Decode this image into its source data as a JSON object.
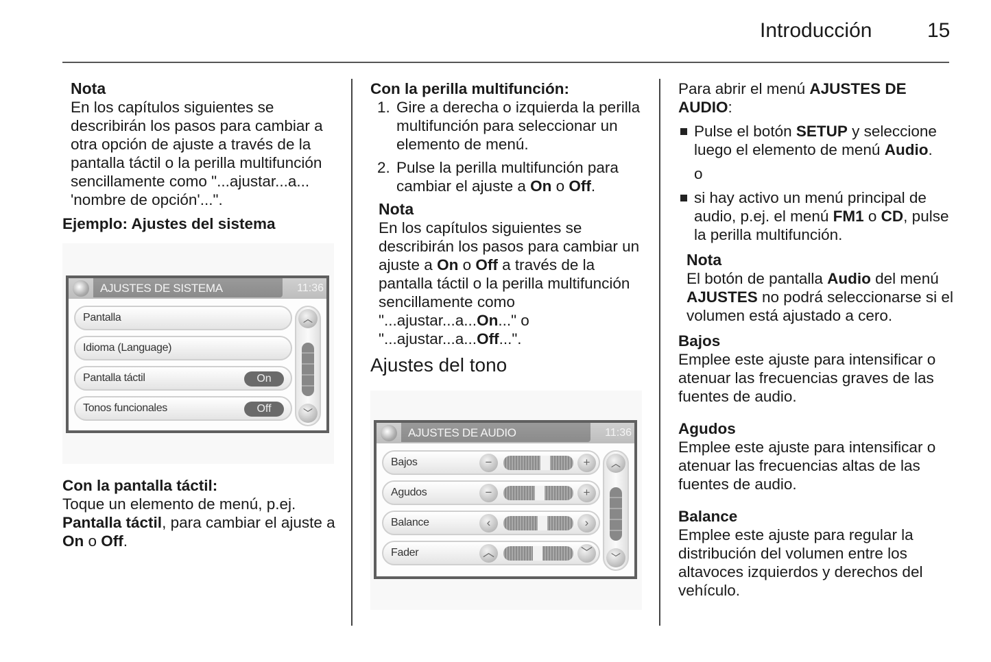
{
  "header": {
    "title": "Introducción",
    "page_number": "15"
  },
  "col1": {
    "note_title": "Nota",
    "note_text": "En los capítulos siguientes se describirán los pasos para cambiar a otra opción de ajuste a través de la pantalla táctil o la perilla multifunción sencillamente como \"...ajustar...a... 'nombre de opción'...\".",
    "example_heading": "Ejemplo: Ajustes del sistema",
    "system_screen": {
      "title": "AJUSTES DE SISTEMA",
      "clock": "11:36",
      "items": [
        {
          "label": "Pantalla",
          "toggle": null
        },
        {
          "label": "Idioma (Language)",
          "toggle": null
        },
        {
          "label": "Pantalla táctil",
          "toggle": "On"
        },
        {
          "label": "Tonos funcionales",
          "toggle": "Off"
        }
      ],
      "scroll_up": "︿",
      "scroll_down": "﹀"
    },
    "touch_heading": "Con la pantalla táctil:",
    "touch_text_1": "Toque un elemento de menú, p.ej.",
    "touch_bold": "Pantalla táctil",
    "touch_text_2": ", para cambiar el ajuste a ",
    "on": "On",
    "or": " o ",
    "off": "Off",
    "period": "."
  },
  "col2": {
    "knob_heading": "Con la perilla multifunción:",
    "steps": [
      {
        "num": "1.",
        "text": "Gire a derecha o izquierda la perilla multifunción para seleccionar un elemento de menú."
      },
      {
        "num": "2.",
        "text_a": "Pulse la perilla multifunción para cambiar el ajuste a ",
        "on": "On",
        "or": " o ",
        "off": "Off",
        "end": "."
      }
    ],
    "note_title": "Nota",
    "note_a": "En los capítulos siguientes se describirán los pasos para cambiar un ajuste a ",
    "note_on": "On",
    "note_or": " o ",
    "note_off": "Off",
    "note_b": " a través de la pantalla táctil o la perilla multifunción sencillamente como \"...ajustar...a...",
    "note_on2": "On",
    "note_c": "...\" o \"...ajustar...a...",
    "note_off2": "Off",
    "note_d": "...\".",
    "tone_heading": "Ajustes del tono",
    "audio_screen": {
      "title": "AJUSTES DE AUDIO",
      "clock": "11:36",
      "controls": [
        {
          "label": "Bajos",
          "left_icon": "−",
          "right_icon": "+",
          "left_name": "minus-icon",
          "right_name": "plus-icon",
          "level": 0.6
        },
        {
          "label": "Agudos",
          "left_icon": "−",
          "right_icon": "+",
          "left_name": "minus-icon",
          "right_name": "plus-icon",
          "level": 0.52
        },
        {
          "label": "Balance",
          "left_icon": "‹",
          "right_icon": "›",
          "left_name": "chevron-left-icon",
          "right_name": "chevron-right-icon",
          "level": 0.56
        },
        {
          "label": "Fader",
          "left_icon": "︿",
          "right_icon": "﹀",
          "left_name": "chevron-up-icon",
          "right_name": "chevron-down-icon",
          "level": 0.49
        }
      ],
      "scroll_up": "︿",
      "scroll_down": "﹀"
    }
  },
  "col3": {
    "intro_a": "Para abrir el menú ",
    "intro_bold": "AJUSTES DE AUDIO",
    "intro_b": ":",
    "bullet1_a": "Pulse el botón ",
    "bullet1_setup": "SETUP",
    "bullet1_b": " y seleccione luego el elemento de menú ",
    "bullet1_audio": "Audio",
    "bullet1_c": ".",
    "or_word": "o",
    "bullet2_a": "si hay activo un menú principal de audio, p.ej. el menú ",
    "bullet2_fm1": "FM1",
    "bullet2_or": " o ",
    "bullet2_cd": "CD",
    "bullet2_b": ", pulse la perilla multifunción.",
    "note_title": "Nota",
    "note_a": "El botón de pantalla ",
    "note_audio": "Audio",
    "note_b": " del menú ",
    "note_ajustes": "AJUSTES",
    "note_c": " no podrá seleccionarse si el volumen está ajustado a cero.",
    "sections": [
      {
        "title": "Bajos",
        "text": "Emplee este ajuste para intensificar o atenuar las frecuencias graves de las fuentes de audio."
      },
      {
        "title": "Agudos",
        "text": "Emplee este ajuste para intensificar o atenuar las frecuencias altas de las fuentes de audio."
      },
      {
        "title": "Balance",
        "text": "Emplee este ajuste para regular la distribución del volumen entre los altavoces izquierdos y derechos del vehículo."
      }
    ]
  }
}
